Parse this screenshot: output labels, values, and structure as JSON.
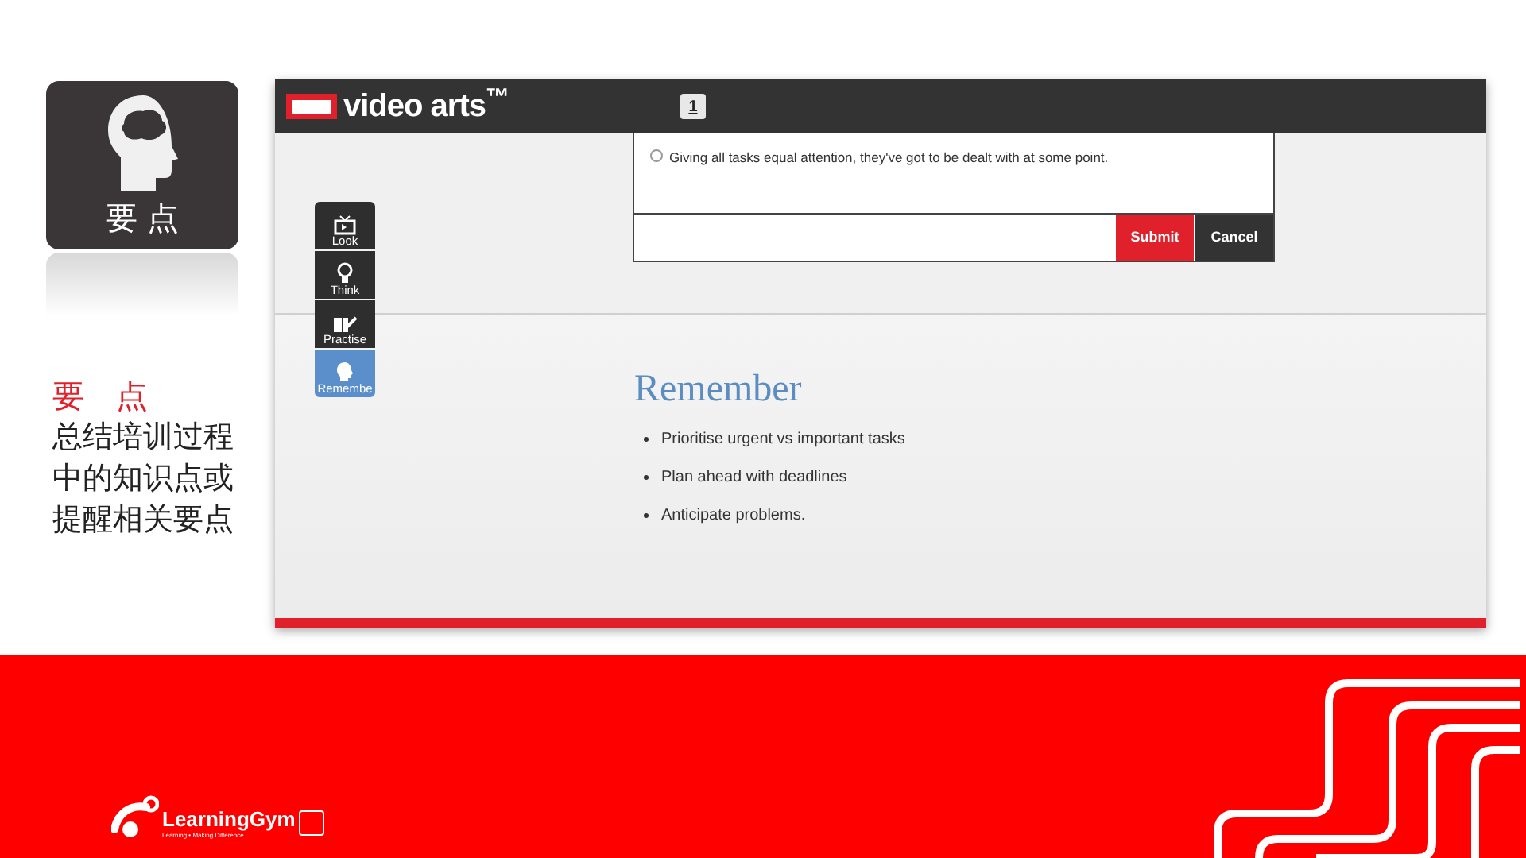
{
  "tile": {
    "label": "要 点"
  },
  "description": {
    "title": "要　点",
    "lines": [
      "总结培训过程",
      "中的知识点或",
      "提醒相关要点"
    ]
  },
  "app": {
    "brand": "video arts$^{™}$",
    "page_badge": "1",
    "question": {
      "option": {
        "text": "Giving all tasks equal attention, they've got to be dealt with at some point.",
        "selected": false
      },
      "buttons": [
        {
          "label": "Submit",
          "kind": "primary"
        },
        {
          "label": "Cancel",
          "kind": "secondary"
        }
      ]
    },
    "nav": [
      {
        "label": "Look",
        "kind": "look",
        "selected": false
      },
      {
        "label": "Think",
        "kind": "think",
        "selected": false
      },
      {
        "label": "Practise",
        "kind": "practise",
        "selected": false
      },
      {
        "label": "Remembe",
        "kind": "remember",
        "selected": true
      }
    ],
    "heading": "Remember",
    "bullets": [
      "Prioritise urgent vs important tasks",
      "Plan ahead with deadlines",
      "Anticipate problems."
    ]
  },
  "footer": {
    "logo_text": "LearningGym",
    "tagline": "Learning • Making Difference"
  }
}
